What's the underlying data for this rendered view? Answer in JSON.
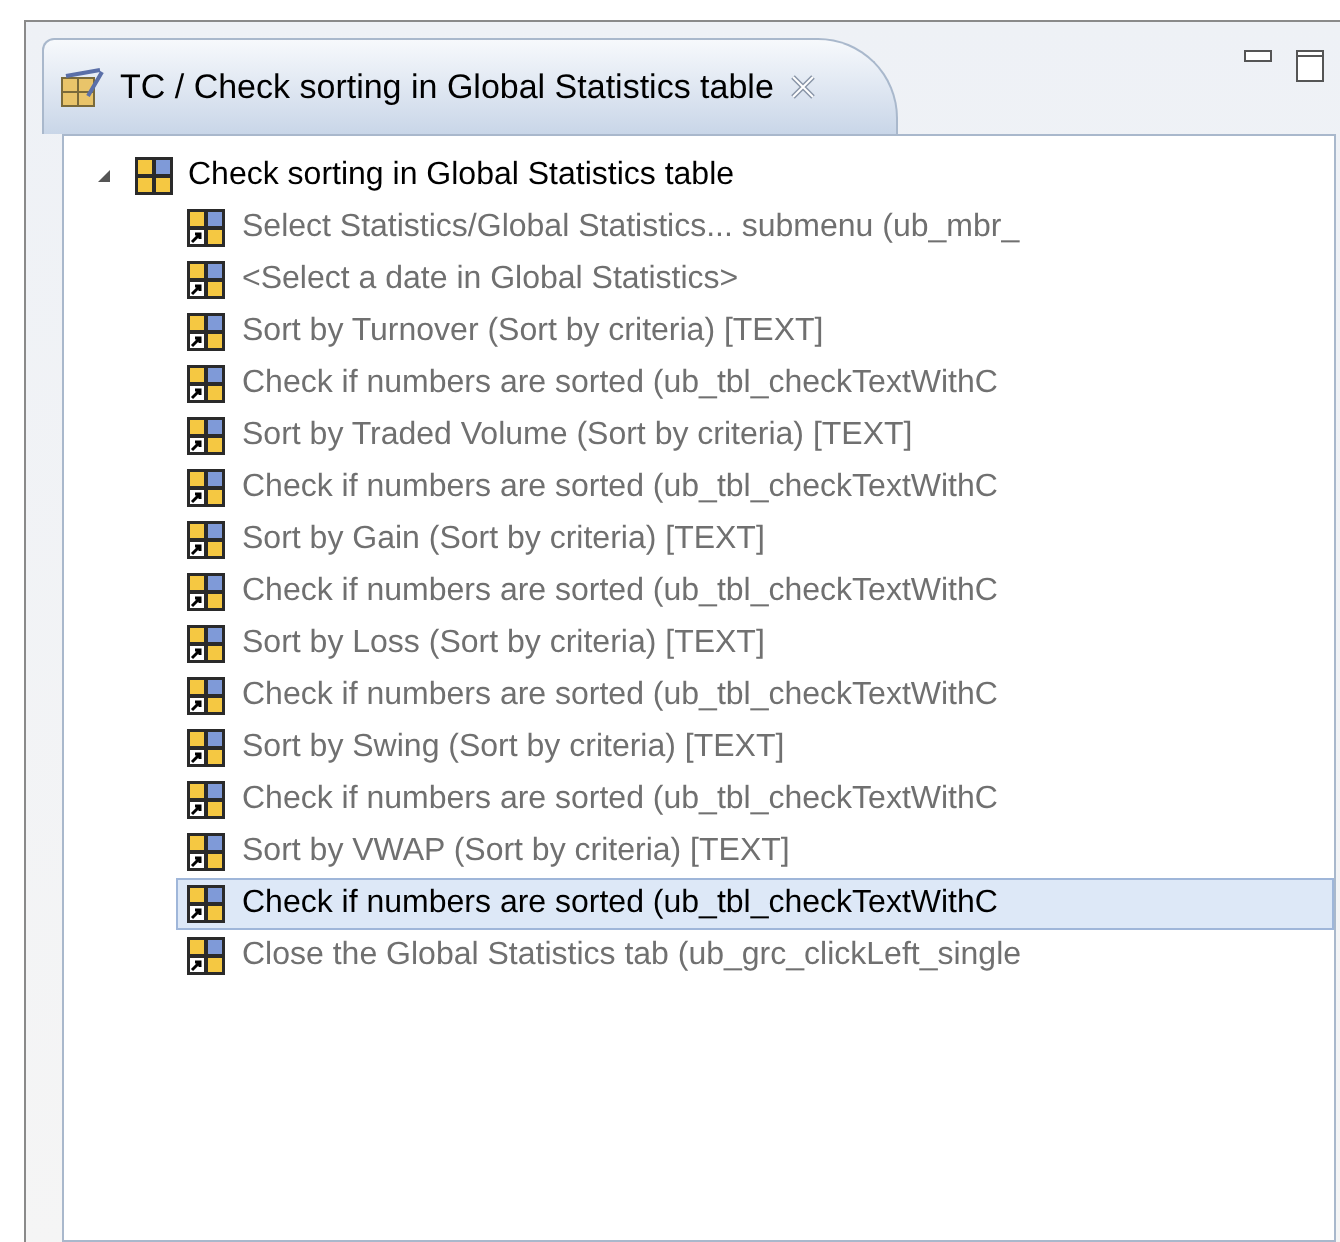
{
  "tab": {
    "title": "TC / Check sorting in Global Statistics table"
  },
  "tree": {
    "label": "Check sorting in Global Statistics table",
    "expanded": true,
    "children": [
      {
        "label": "Select Statistics/Global Statistics... submenu (ub_mbr_",
        "selected": false
      },
      {
        "label": "<Select a date in Global Statistics>",
        "selected": false
      },
      {
        "label": "Sort by Turnover (Sort by criteria) [TEXT]",
        "selected": false
      },
      {
        "label": "Check if numbers are sorted (ub_tbl_checkTextWithC",
        "selected": false
      },
      {
        "label": "Sort by Traded Volume (Sort by criteria) [TEXT]",
        "selected": false
      },
      {
        "label": "Check if numbers are sorted (ub_tbl_checkTextWithC",
        "selected": false
      },
      {
        "label": "Sort by Gain (Sort by criteria) [TEXT]",
        "selected": false
      },
      {
        "label": "Check if numbers are sorted (ub_tbl_checkTextWithC",
        "selected": false
      },
      {
        "label": "Sort by Loss (Sort by criteria) [TEXT]",
        "selected": false
      },
      {
        "label": "Check if numbers are sorted (ub_tbl_checkTextWithC",
        "selected": false
      },
      {
        "label": "Sort by Swing (Sort by criteria) [TEXT]",
        "selected": false
      },
      {
        "label": "Check if numbers are sorted (ub_tbl_checkTextWithC",
        "selected": false
      },
      {
        "label": "Sort by VWAP (Sort by criteria) [TEXT]",
        "selected": false
      },
      {
        "label": "Check if numbers are sorted (ub_tbl_checkTextWithC",
        "selected": true
      },
      {
        "label": "Close the Global Statistics tab (ub_grc_clickLeft_single",
        "selected": false
      }
    ]
  }
}
